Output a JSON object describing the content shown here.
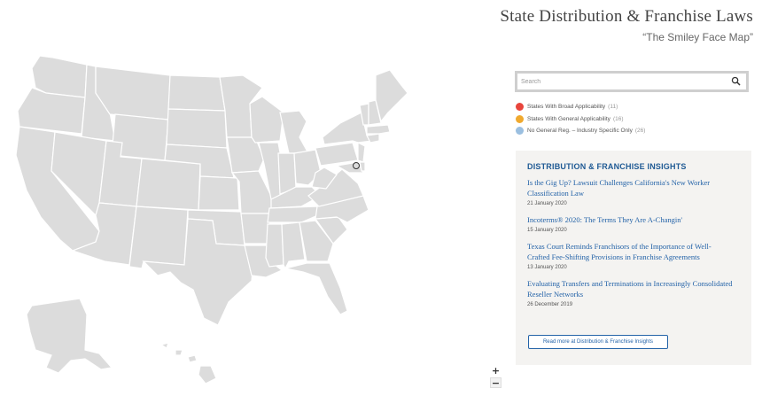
{
  "header": {
    "title": "State Distribution & Franchise Laws",
    "subtitle": "“The Smiley Face Map”"
  },
  "search": {
    "placeholder": "Search"
  },
  "legend": [
    {
      "label": "States With Broad Applicability",
      "count": "(11)",
      "color": "#e8453c"
    },
    {
      "label": "States With General Applicability",
      "count": "(16)",
      "color": "#f0a92e"
    },
    {
      "label": "No General Reg. – Industry Specific Only",
      "count": "(26)",
      "color": "#9bbfe0"
    }
  ],
  "map": {
    "state_fill": "#dcdcdc",
    "zoom_in_label": "+",
    "zoom_out_label": "−"
  },
  "insights": {
    "heading": "DISTRIBUTION & FRANCHISE INSIGHTS",
    "articles": [
      {
        "title": "Is the Gig Up? Lawsuit Challenges California's New Worker Classification Law",
        "date": "21 January 2020"
      },
      {
        "title": "Incoterms® 2020: The Terms They Are A-Changin'",
        "date": "15 January 2020"
      },
      {
        "title": "Texas Court Reminds Franchisors of the Importance of Well-Crafted Fee-Shifting Provisions in Franchise Agreements",
        "date": "13 January 2020"
      },
      {
        "title": "Evaluating Transfers and Terminations in Increasingly Consolidated Reseller Networks",
        "date": "26 December 2019"
      }
    ],
    "read_more": "Read more at Distribution & Franchise Insights"
  }
}
